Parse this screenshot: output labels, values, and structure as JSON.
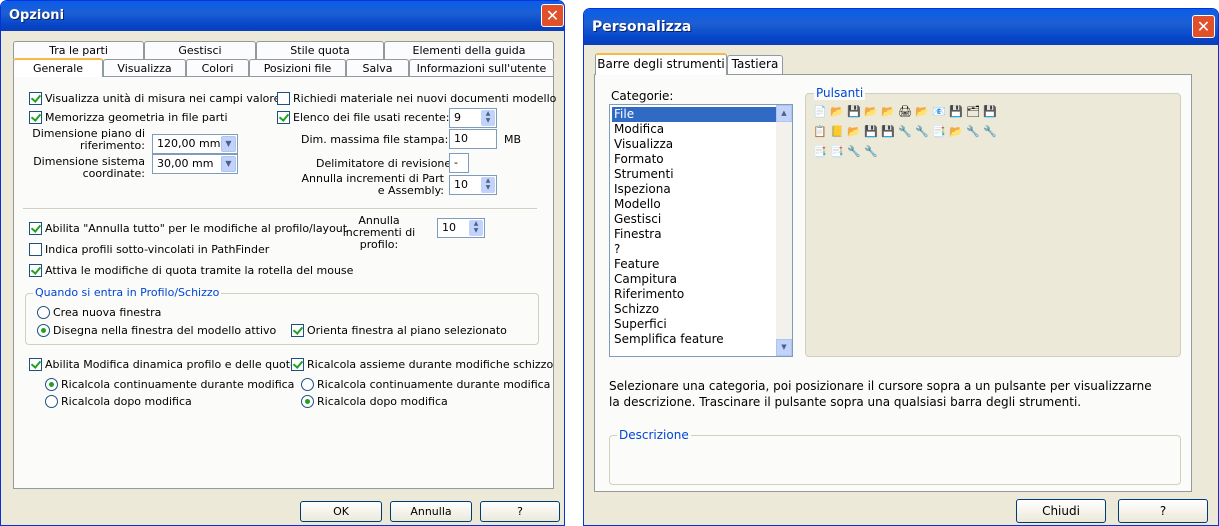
{
  "opzioni": {
    "title": "Opzioni",
    "tabs_row1": [
      "Tra le parti",
      "Gestisci",
      "Stile quota",
      "Elementi della guida"
    ],
    "tabs_row2": [
      "Generale",
      "Visualizza",
      "Colori",
      "Posizioni file",
      "Salva",
      "Informazioni sull'utente"
    ],
    "cb_visualizza_unita": "Visualizza unità di misura nei campi valore",
    "cb_memorizza_geometria": "Memorizza geometria in file parti",
    "lbl_dim_piano": "Dimensione piano di riferimento:",
    "val_dim_piano": "120,00 mm",
    "lbl_dim_sistema": "Dimensione sistema coordinate:",
    "val_dim_sistema": "30,00 mm",
    "cb_richiedi_materiale": "Richiedi materiale nei nuovi documenti modello",
    "cb_elenco_file": "Elenco dei file usati recente:",
    "val_elenco_file": "9",
    "lbl_dim_massima": "Dim. massima file stampa:",
    "val_dim_massima": "10",
    "unit_mb": "MB",
    "lbl_delimitatore": "Delimitatore di revisione:",
    "val_delimitatore": "-",
    "lbl_annulla_incrementi": "Annulla incrementi di Part e Assembly:",
    "val_annulla_incrementi": "10",
    "cb_abilita_annulla": "Abilita \"Annulla tutto\" per le modifiche al profilo/layout",
    "lbl_annulla_profilo": "Annulla incrementi di profilo:",
    "val_annulla_profilo": "10",
    "cb_indica_profili": "Indica profili sotto-vincolati in PathFinder",
    "cb_attiva_modifiche": "Attiva le modifiche di quota tramite la rotella del mouse",
    "group_title": "Quando si entra in Profilo/Schizzo",
    "rb_crea_finestra": "Crea nuova finestra",
    "rb_disegna_finestra": "Disegna nella finestra del modello attivo",
    "cb_orienta_finestra": "Orienta finestra al piano selezionato",
    "cb_abilita_modifica": "Abilita Modifica dinamica profilo e delle quote",
    "rb_ricalcola_cont_1": "Ricalcola continuamente durante modifica",
    "rb_ricalcola_dopo_1": "Ricalcola dopo modifica",
    "cb_ricalcola_assieme": "Ricalcola assieme durante modifiche schizzo",
    "rb_ricalcola_cont_2": "Ricalcola continuamente durante modifica",
    "rb_ricalcola_dopo_2": "Ricalcola dopo modifica",
    "btn_ok": "OK",
    "btn_annulla": "Annulla",
    "btn_help": "?"
  },
  "personalizza": {
    "title": "Personalizza",
    "tabs": [
      "Barre degli strumenti",
      "Tastiera"
    ],
    "categorie_label": "Categorie:",
    "categorie": [
      "File",
      "Modifica",
      "Visualizza",
      "Formato",
      "Strumenti",
      "Ispeziona",
      "Modello",
      "Gestisci",
      "Finestra",
      "?",
      "Feature",
      "Campitura",
      "Riferimento",
      "Schizzo",
      "Superfici",
      "Semplifica feature"
    ],
    "selected_category": "File",
    "pulsanti_label": "Pulsanti",
    "instructions": "Selezionare una categoria, poi posizionare il cursore sopra a un pulsante per visualizzarne la descrizione. Trascinare il pulsante sopra una qualsiasi barra degli strumenti.",
    "descrizione_label": "Descrizione",
    "btn_chiudi": "Chiudi",
    "btn_help": "?"
  },
  "colors": {
    "title_blue": "#0a5ee8",
    "close_red": "#e0502b",
    "selection": "#316ac5",
    "group_blue": "#0046d5",
    "dialog_bg": "#ece9d8"
  }
}
